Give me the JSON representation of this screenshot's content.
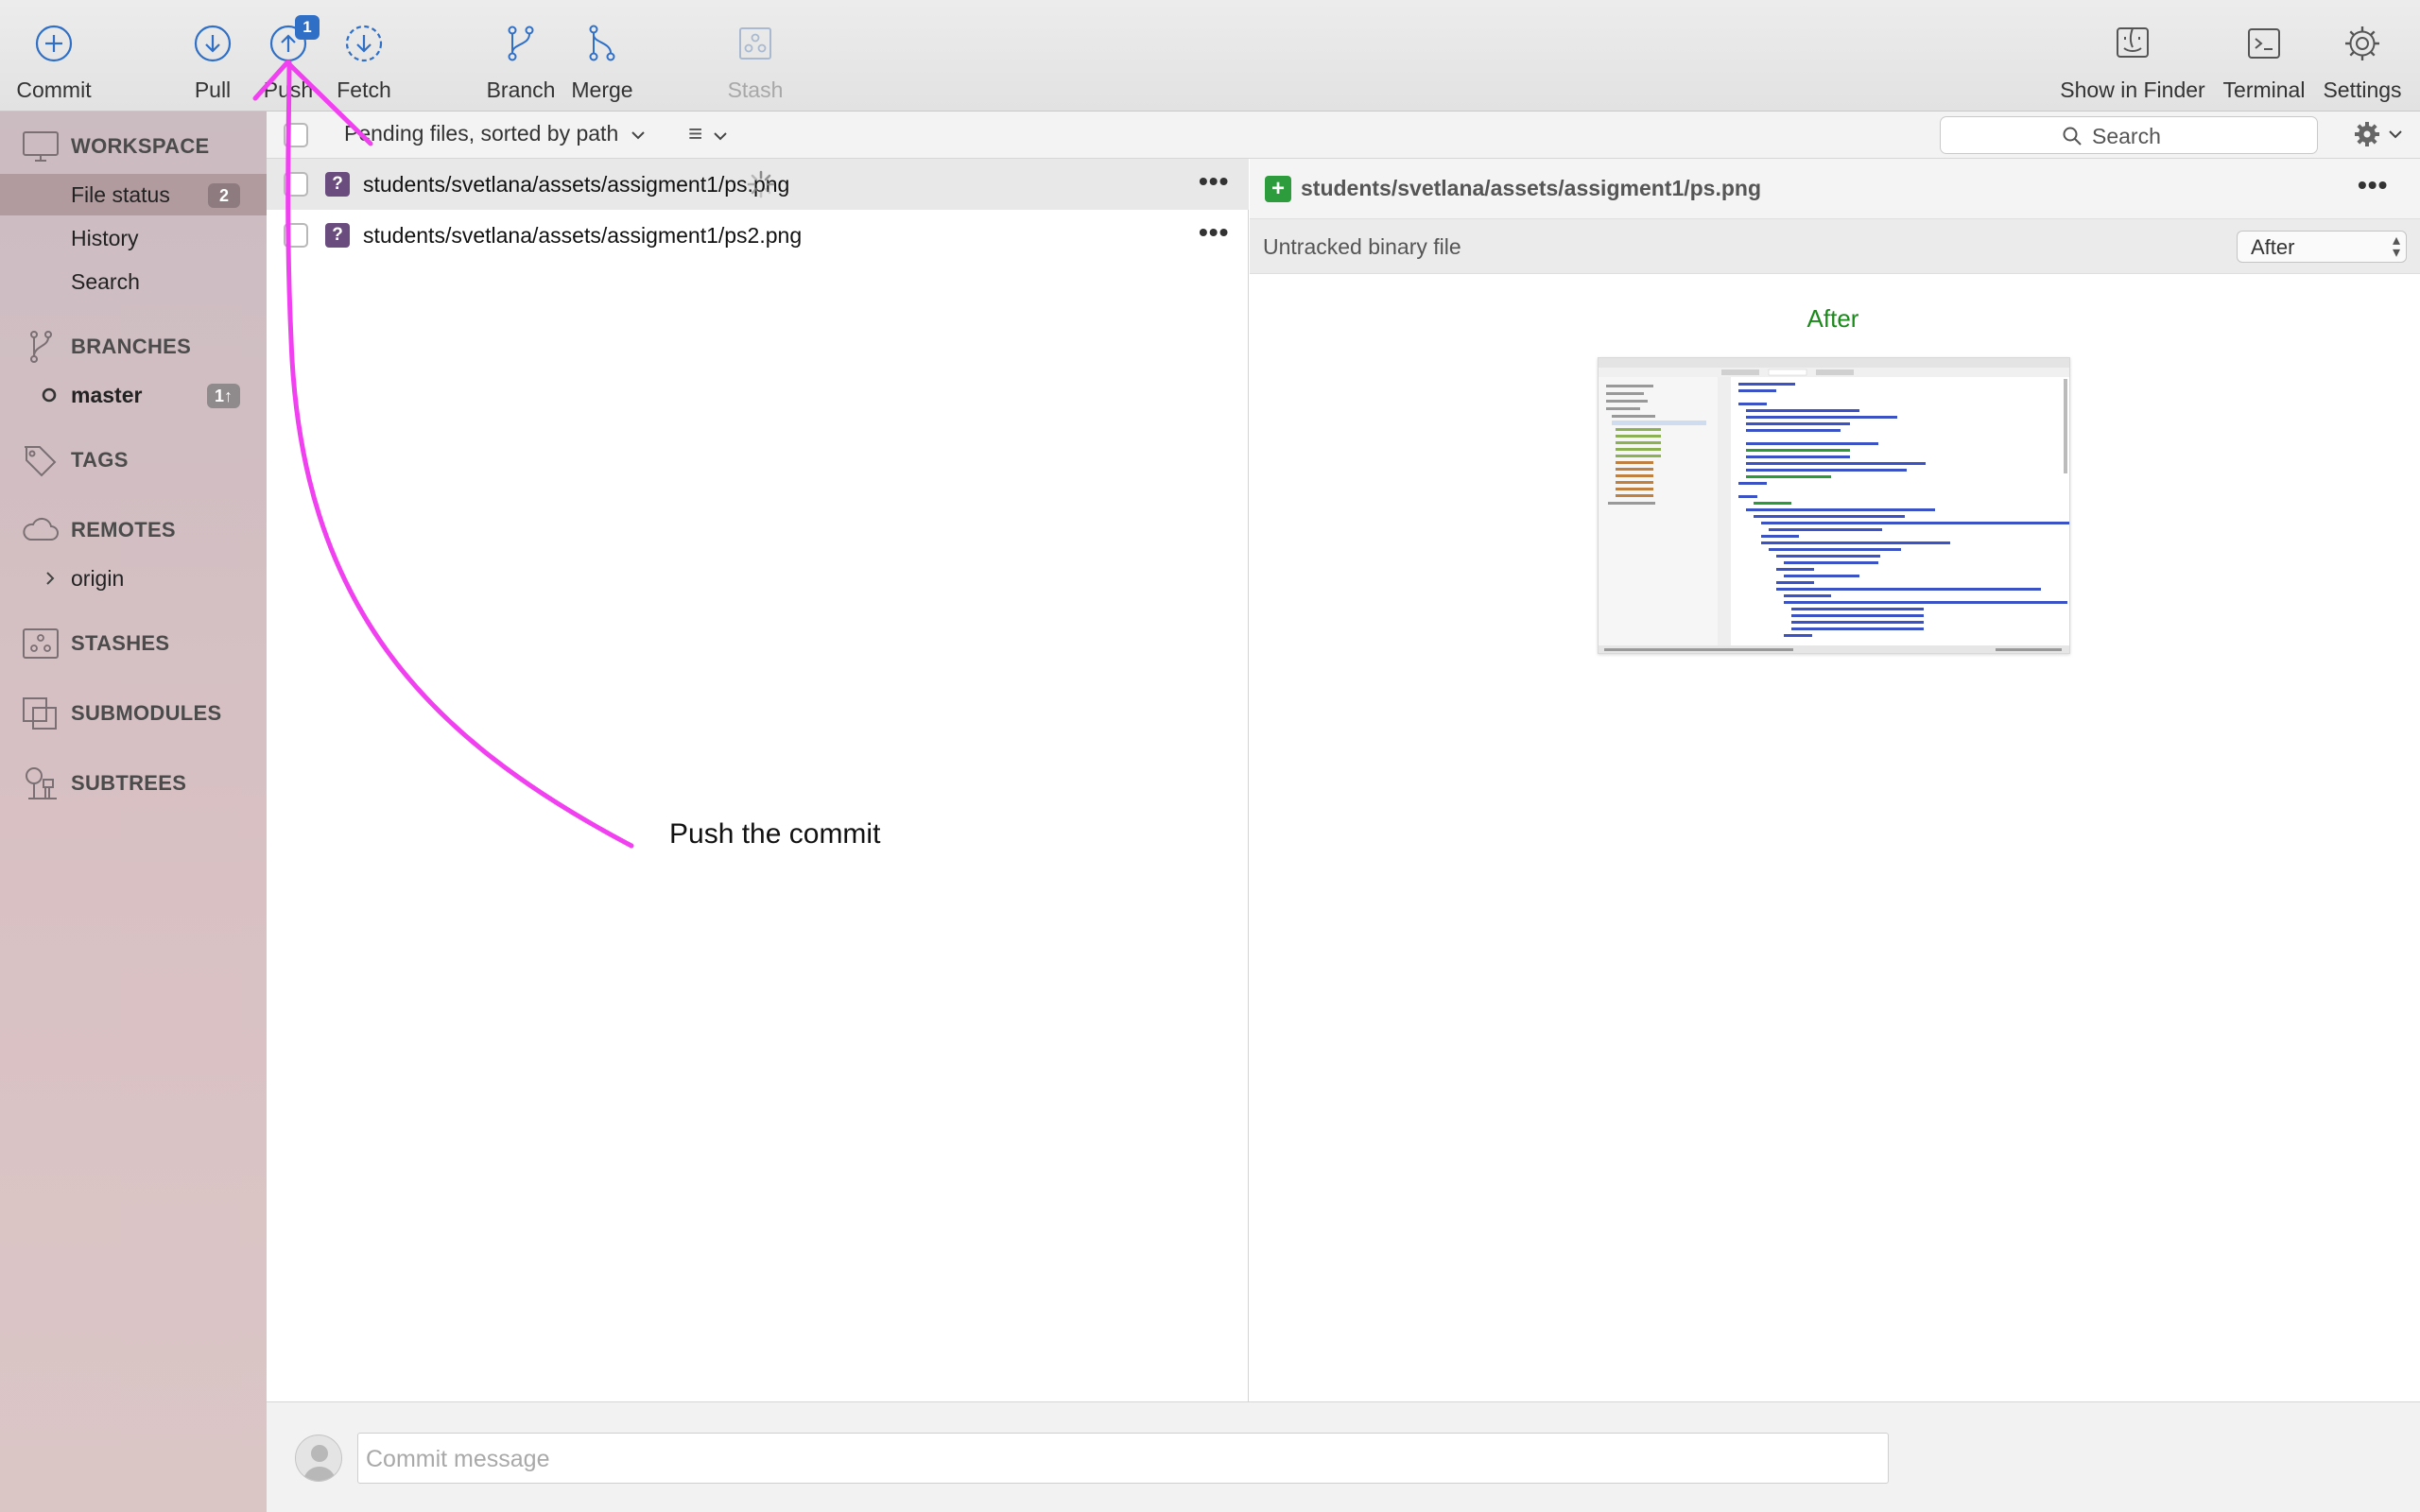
{
  "toolbar": {
    "commit": "Commit",
    "pull": "Pull",
    "push": "Push",
    "push_badge": "1",
    "fetch": "Fetch",
    "branch": "Branch",
    "merge": "Merge",
    "stash": "Stash",
    "show_in_finder": "Show in Finder",
    "terminal": "Terminal",
    "settings": "Settings"
  },
  "sidebar": {
    "workspace": "WORKSPACE",
    "file_status": "File status",
    "file_status_count": "2",
    "history": "History",
    "search": "Search",
    "branches": "BRANCHES",
    "master": "master",
    "master_badge": "1↑",
    "tags": "TAGS",
    "remotes": "REMOTES",
    "origin": "origin",
    "stashes": "STASHES",
    "submodules": "SUBMODULES",
    "subtrees": "SUBTREES"
  },
  "files": {
    "sort_label": "Pending files, sorted by path",
    "list_toggle": "≡",
    "search_placeholder": "Search",
    "rows": [
      {
        "status": "?",
        "path": "students/svetlana/assets/assigment1/ps.png"
      },
      {
        "status": "?",
        "path": "students/svetlana/assets/assigment1/ps2.png"
      }
    ],
    "more": "•••"
  },
  "diff": {
    "status": "+",
    "path": "students/svetlana/assets/assigment1/ps.png",
    "more": "•••",
    "description": "Untracked binary file",
    "view_select": "After",
    "after_label": "After"
  },
  "commit": {
    "placeholder": "Commit message"
  },
  "annotation": {
    "text": "Push the commit",
    "color": "#f040f0"
  },
  "colors": {
    "toolbar_icon": "#2f6fc6",
    "sidebar_selected": "#b19b9f",
    "untracked_badge": "#6b4c7e",
    "added_badge": "#2c9c3c",
    "after_label": "#1a8a1a"
  }
}
